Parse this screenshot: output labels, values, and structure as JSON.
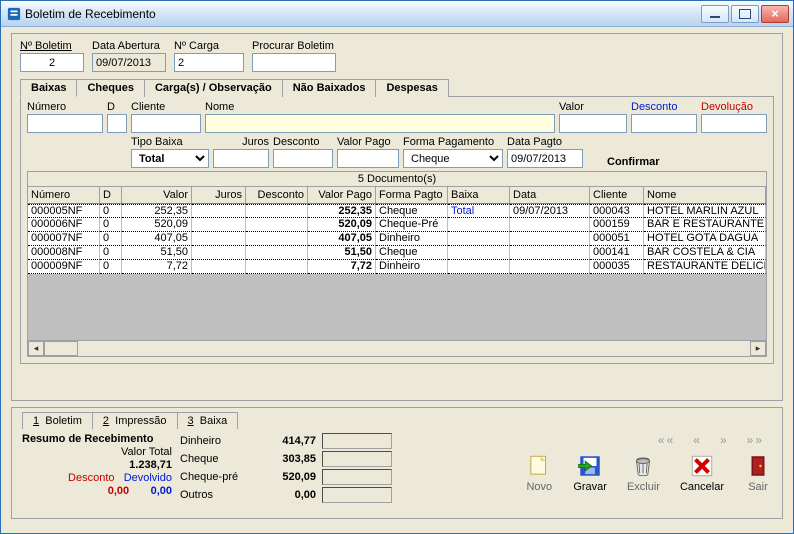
{
  "window": {
    "title": "Boletim de Recebimento"
  },
  "top_fields": {
    "n_boletim_label": "Nº Boletim",
    "n_boletim": "2",
    "data_abertura_label": "Data Abertura",
    "data_abertura": "09/07/2013",
    "n_carga_label": "Nº Carga",
    "n_carga": "2",
    "procurar_label": "Procurar Boletim",
    "procurar": ""
  },
  "tabs": {
    "t0": "Baixas",
    "t1": "Cheques",
    "t2": "Carga(s) / Observação",
    "t3": "Não Baixados",
    "t4": "Despesas",
    "active": 0
  },
  "filter_row1": {
    "numero_label": "Número",
    "numero": "",
    "d_label": "D",
    "d": "",
    "cliente_label": "Cliente",
    "cliente": "",
    "nome_label": "Nome",
    "nome": "",
    "valor_label": "Valor",
    "valor": "",
    "desconto_label": "Desconto",
    "desconto": "",
    "devolucao_label": "Devolução",
    "devolucao": ""
  },
  "filter_row2": {
    "tipo_baixa_label": "Tipo Baixa",
    "tipo_baixa": "Total",
    "juros_label": "Juros",
    "juros": "",
    "desconto_label": "Desconto",
    "desconto": "",
    "valor_pago_label": "Valor Pago",
    "valor_pago": "",
    "forma_pgto_label": "Forma Pagamento",
    "forma_pgto": "Cheque",
    "data_pgto_label": "Data Pagto",
    "data_pgto": "09/07/2013",
    "confirmar": "Confirmar"
  },
  "grid": {
    "title": "5 Documento(s)",
    "headers": {
      "numero": "Número",
      "d": "D",
      "valor": "Valor",
      "juros": "Juros",
      "desconto": "Desconto",
      "valor_pago": "Valor Pago",
      "forma": "Forma Pagto",
      "baixa": "Baixa",
      "data": "Data",
      "cliente": "Cliente",
      "nome": "Nome"
    },
    "rows": [
      {
        "numero": "000005NF",
        "d": "0",
        "valor": "252,35",
        "juros": "",
        "desconto": "",
        "valor_pago": "252,35",
        "forma": "Cheque",
        "baixa": "Total",
        "data": "09/07/2013",
        "cliente": "000043",
        "nome": "HOTEL MARLIN AZUL"
      },
      {
        "numero": "000006NF",
        "d": "0",
        "valor": "520,09",
        "juros": "",
        "desconto": "",
        "valor_pago": "520,09",
        "forma": "Cheque-Pré",
        "baixa": "",
        "data": "",
        "cliente": "000159",
        "nome": "BAR E RESTAURANTE ESQ"
      },
      {
        "numero": "000007NF",
        "d": "0",
        "valor": "407,05",
        "juros": "",
        "desconto": "",
        "valor_pago": "407,05",
        "forma": "Dinheiro",
        "baixa": "",
        "data": "",
        "cliente": "000051",
        "nome": "HOTEL GOTA DAGUA"
      },
      {
        "numero": "000008NF",
        "d": "0",
        "valor": "51,50",
        "juros": "",
        "desconto": "",
        "valor_pago": "51,50",
        "forma": "Cheque",
        "baixa": "",
        "data": "",
        "cliente": "000141",
        "nome": "BAR COSTELA & CIA"
      },
      {
        "numero": "000009NF",
        "d": "0",
        "valor": "7,72",
        "juros": "",
        "desconto": "",
        "valor_pago": "7,72",
        "forma": "Dinheiro",
        "baixa": "",
        "data": "",
        "cliente": "000035",
        "nome": "RESTAURANTE DELICIAS D"
      }
    ]
  },
  "bottom_tabs": {
    "t0": "1  Boletim",
    "t1": "2  Impressão",
    "t2": "3  Baixa"
  },
  "summary": {
    "title": "Resumo de Recebimento",
    "valor_total_label": "Valor Total",
    "valor_total": "1.238,71",
    "desconto_label": "Desconto",
    "desconto": "0,00",
    "devolvido_label": "Devolvido",
    "devolvido": "0,00",
    "dinheiro_label": "Dinheiro",
    "dinheiro": "414,77",
    "cheque_label": "Cheque",
    "cheque": "303,85",
    "cheque_pre_label": "Cheque-pré",
    "cheque_pre": "520,09",
    "outros_label": "Outros",
    "outros": "0,00"
  },
  "toolbar": {
    "novo": "Novo",
    "gravar": "Gravar",
    "excluir": "Excluir",
    "cancelar": "Cancelar",
    "sair": "Sair",
    "nav_first": "««",
    "nav_prev": "«",
    "nav_next": "»",
    "nav_last": "»»"
  }
}
